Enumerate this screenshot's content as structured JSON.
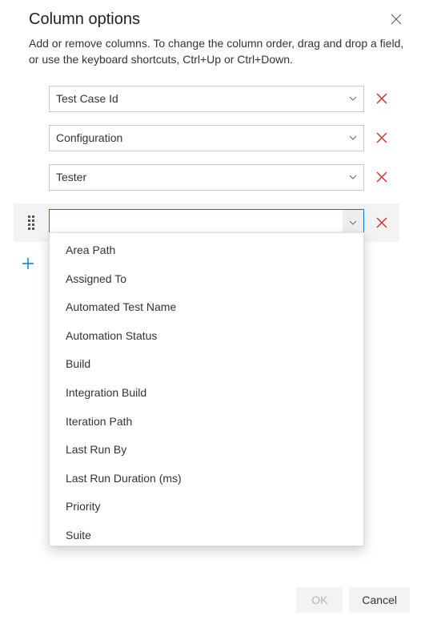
{
  "dialog": {
    "title": "Column options",
    "description": "Add or remove columns. To change the column order, drag and drop a field, or use the keyboard shortcuts, Ctrl+Up or Ctrl+Down."
  },
  "columns": [
    {
      "label": "Test Case Id"
    },
    {
      "label": "Configuration"
    },
    {
      "label": "Tester"
    }
  ],
  "active_input": {
    "value": "",
    "placeholder": ""
  },
  "dropdown_options": [
    "Area Path",
    "Assigned To",
    "Automated Test Name",
    "Automation Status",
    "Build",
    "Integration Build",
    "Iteration Path",
    "Last Run By",
    "Last Run Duration (ms)",
    "Priority",
    "Suite"
  ],
  "footer": {
    "ok_label": "OK",
    "cancel_label": "Cancel"
  }
}
